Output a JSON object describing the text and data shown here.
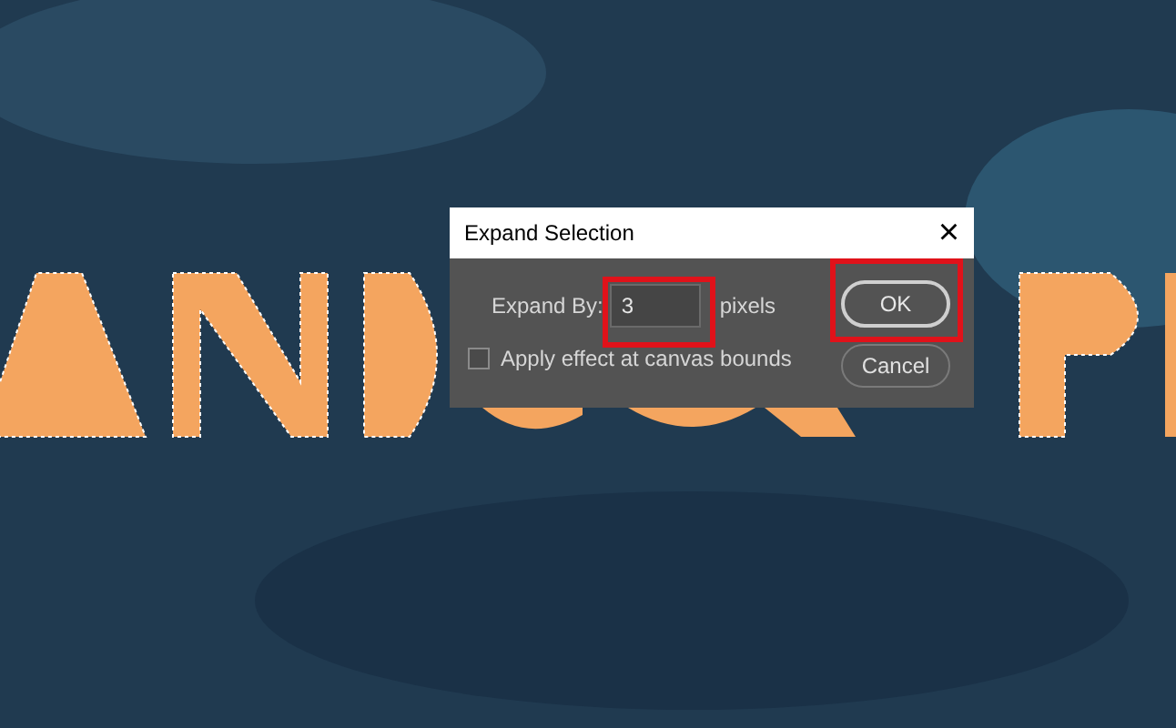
{
  "dialog": {
    "title": "Expand Selection",
    "close": "×",
    "expand_by": {
      "label": "Expand By:",
      "value": "3",
      "unit": "pixels",
      "highlighted": true
    },
    "canvas_bounds": {
      "label": "Apply effect at canvas bounds",
      "checked": false
    },
    "buttons": [
      {
        "label": "OK",
        "default": true,
        "highlighted": true
      },
      {
        "label": "Cancel",
        "default": false,
        "highlighted": false
      }
    ]
  }
}
